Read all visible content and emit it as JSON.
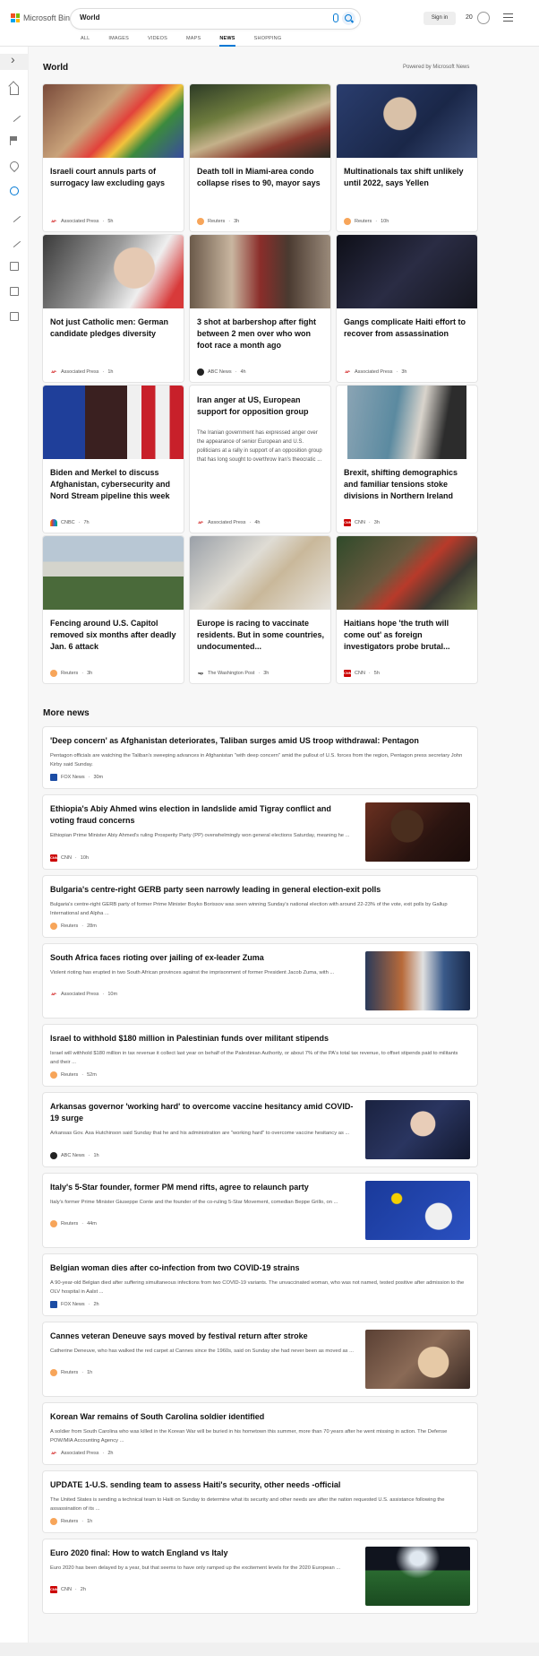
{
  "header": {
    "logo_text": "Microsoft Bing",
    "search_value": "World",
    "signin_label": "Sign in",
    "rewards_count": "20",
    "tabs": [
      {
        "label": "ALL"
      },
      {
        "label": "IMAGES"
      },
      {
        "label": "VIDEOS"
      },
      {
        "label": "MAPS"
      },
      {
        "label": "NEWS"
      },
      {
        "label": "SHOPPING"
      }
    ],
    "active_tab": "NEWS"
  },
  "colors": {
    "accent": "#0078d4",
    "background": "#f7f7f7"
  },
  "section": {
    "title": "World",
    "powered_by": "Powered by Microsoft News"
  },
  "cards": [
    {
      "title": "Israeli court annuls parts of surrogacy law excluding gays",
      "source": "Associated Press",
      "time": "5h",
      "source_icon": "ap"
    },
    {
      "title": "Death toll in Miami-area condo collapse rises to 90, mayor says",
      "source": "Reuters",
      "time": "3h",
      "source_icon": "reuters"
    },
    {
      "title": "Multinationals tax shift unlikely until 2022, says Yellen",
      "source": "Reuters",
      "time": "10h",
      "source_icon": "reuters"
    },
    {
      "title": "Not just Catholic men: German candidate pledges diversity",
      "source": "Associated Press",
      "time": "1h",
      "source_icon": "ap"
    },
    {
      "title": "3 shot at barbershop after fight between 2 men over who won foot race a month ago",
      "source": "ABC News",
      "time": "4h",
      "source_icon": "abc"
    },
    {
      "title": "Gangs complicate Haiti effort to recover from assassination",
      "source": "Associated Press",
      "time": "3h",
      "source_icon": "ap"
    },
    {
      "title": "Biden and Merkel to discuss Afghanistan, cybersecurity and Nord Stream pipeline this week",
      "source": "CNBC",
      "time": "7h",
      "source_icon": "cnbc"
    },
    {
      "title": "Iran anger at US, European support for opposition group",
      "snippet": "The Iranian government has expressed anger over the appearance of senior European and U.S. politicians at a rally in support of an opposition group that has long sought to overthrow Iran's theocratic ...",
      "source": "Associated Press",
      "time": "4h",
      "source_icon": "ap"
    },
    {
      "title": "Brexit, shifting demographics and familiar tensions stoke divisions in Northern Ireland",
      "source": "CNN",
      "time": "3h",
      "source_icon": "cnn"
    },
    {
      "title": "Fencing around U.S. Capitol removed six months after deadly Jan. 6 attack",
      "source": "Reuters",
      "time": "3h",
      "source_icon": "reuters"
    },
    {
      "title": "Europe is racing to vaccinate residents. But in some countries, undocumented...",
      "source": "The Washington Post",
      "time": "3h",
      "source_icon": "wp"
    },
    {
      "title": "Haitians hope 'the truth will come out' as foreign investigators probe brutal...",
      "source": "CNN",
      "time": "5h",
      "source_icon": "cnn"
    }
  ],
  "more_news": {
    "title": "More news",
    "items": [
      {
        "title": "'Deep concern' as Afghanistan deteriorates, Taliban surges amid US troop withdrawal: Pentagon",
        "snippet": "Pentagon officials are watching the Taliban's sweeping advances in Afghanistan \"with deep concern\" amid the pullout of U.S. forces from the region, Pentagon press secretary John Kirby said Sunday.",
        "source": "FOX News",
        "time": "30m",
        "source_icon": "fox"
      },
      {
        "title": "Ethiopia's Abiy Ahmed wins election in landslide amid Tigray conflict and voting fraud concerns",
        "snippet": "Ethiopian Prime Minister Abiy Ahmed's ruling Prosperity Party (PP) overwhelmingly won general elections Saturday, meaning he ...",
        "source": "CNN",
        "time": "10h",
        "source_icon": "cnn"
      },
      {
        "title": "Bulgaria's centre-right GERB party seen narrowly leading in general election-exit polls",
        "snippet": "Bulgaria's centre-right GERB party of former Prime Minister Boyko Borissov was seen winning Sunday's national election with around 22-23% of the vote, exit polls by Gallup International and Alpha ...",
        "source": "Reuters",
        "time": "28m",
        "source_icon": "reuters"
      },
      {
        "title": "South Africa faces rioting over jailing of ex-leader Zuma",
        "snippet": "Violent rioting has erupted in two South African provinces against the imprisonment of former President Jacob Zuma, with ...",
        "source": "Associated Press",
        "time": "10m",
        "source_icon": "ap"
      },
      {
        "title": "Israel to withhold $180 million in Palestinian funds over militant stipends",
        "snippet": "Israel will withhold $180 million in tax revenue it collect last year on behalf of the Palestinian Authority, or about 7% of the PA's total tax revenue, to offset stipends paid to militants and their ...",
        "source": "Reuters",
        "time": "52m",
        "source_icon": "reuters"
      },
      {
        "title": "Arkansas governor 'working hard' to overcome vaccine hesitancy amid COVID-19 surge",
        "snippet": "Arkansas Gov. Asa Hutchinson said Sunday that he and his administration are \"working hard\" to overcome vaccine hesitancy as ...",
        "source": "ABC News",
        "time": "1h",
        "source_icon": "abc"
      },
      {
        "title": "Italy's 5-Star founder, former PM mend rifts, agree to relaunch party",
        "snippet": "Italy's former Prime Minister Giuseppe Conte and the founder of the co-ruling 5-Star Movement, comedian Beppe Grillo, on ...",
        "source": "Reuters",
        "time": "44m",
        "source_icon": "reuters"
      },
      {
        "title": "Belgian woman dies after co-infection from two COVID-19 strains",
        "snippet": "A 90-year-old Belgian died after suffering simultaneous infections from two COVID-19 variants.  The unvaccinated woman, who was not named, tested positive after admission to the OLV hospital in Aalst ...",
        "source": "FOX News",
        "time": "2h",
        "source_icon": "fox"
      },
      {
        "title": "Cannes veteran Deneuve says moved by festival return after stroke",
        "snippet": "Catherine Deneuve, who has walked the red carpet at Cannes since the 1960s, said on Sunday she had never been as moved as ...",
        "source": "Reuters",
        "time": "1h",
        "source_icon": "reuters"
      },
      {
        "title": "Korean War remains of South Carolina soldier identified",
        "snippet": "A soldier from South Carolina who was killed in the Korean War will be buried in his hometown this summer, more than 70 years after he went missing in action. The Defense POW/MIA Accounting Agency ...",
        "source": "Associated Press",
        "time": "2h",
        "source_icon": "ap"
      },
      {
        "title": "UPDATE 1-U.S. sending team to assess Haiti's security, other needs -official",
        "snippet": "The United States is sending a technical team to Haiti on Sunday to determine what its security and other needs are after the nation requested U.S. assistance following the assassination of its ...",
        "source": "Reuters",
        "time": "1h",
        "source_icon": "reuters"
      },
      {
        "title": "Euro 2020 final: How to watch England vs Italy",
        "snippet": "Euro 2020 has been delayed by a year, but that seems to have only ramped up the excitement levels for the 2020 European ...",
        "source": "CNN",
        "time": "2h",
        "source_icon": "cnn"
      }
    ]
  }
}
